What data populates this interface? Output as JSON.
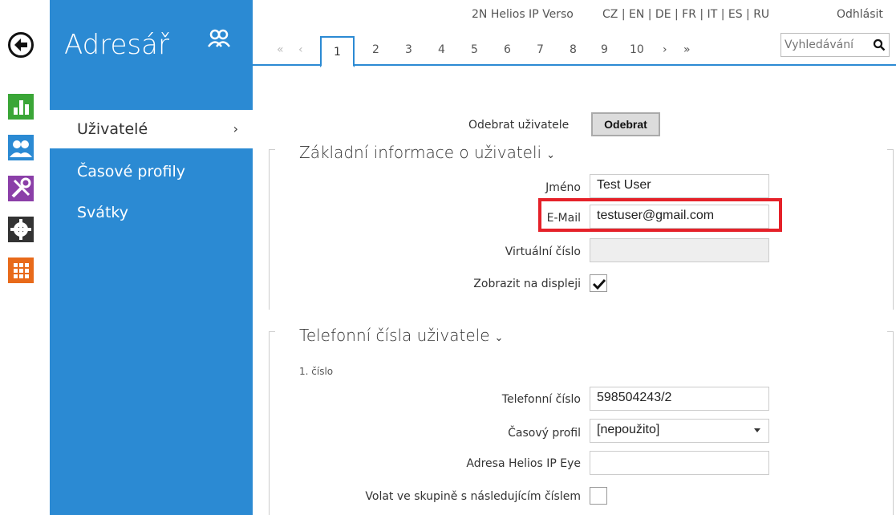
{
  "header": {
    "device": "2N Helios IP Verso",
    "languages": "CZ | EN | DE | FR | IT | ES | RU",
    "logout": "Odhlásit"
  },
  "sidebar": {
    "title": "Adresář",
    "items": [
      {
        "label": "Uživatelé",
        "active": true
      },
      {
        "label": "Časové profily",
        "active": false
      },
      {
        "label": "Svátky",
        "active": false
      }
    ]
  },
  "pager": {
    "first": "«",
    "prev": "‹",
    "pages": [
      "1",
      "2",
      "3",
      "4",
      "5",
      "6",
      "7",
      "8",
      "9",
      "10"
    ],
    "current": "1",
    "next": "›",
    "last": "»"
  },
  "search": {
    "placeholder": "Vyhledávání"
  },
  "remove": {
    "label": "Odebrat uživatele",
    "button": "Odebrat"
  },
  "basic": {
    "title": "Základní informace o uživateli",
    "name_label": "Jméno",
    "name_value": "Test User",
    "email_label": "E-Mail",
    "email_value": "testuser@gmail.com",
    "virtual_label": "Virtuální číslo",
    "virtual_value": "",
    "display_label": "Zobrazit na displeji",
    "display_checked": true
  },
  "phones": {
    "title": "Telefonní čísla uživatele",
    "sub": "1. číslo",
    "phone_label": "Telefonní číslo",
    "phone_value": "598504243/2",
    "profile_label": "Časový profil",
    "profile_value": "[nepoužito]",
    "eye_label": "Adresa Helios IP Eye",
    "eye_value": "",
    "group_label": "Volat ve skupině s následujícím číslem",
    "group_checked": false
  },
  "colors": {
    "accent": "#2b8ad3",
    "highlight": "#e52129",
    "rail_green": "#3aa637",
    "rail_blue": "#2b8ad3",
    "rail_purple": "#8b3fa8",
    "rail_dark": "#333333",
    "rail_orange": "#e86a1a"
  }
}
